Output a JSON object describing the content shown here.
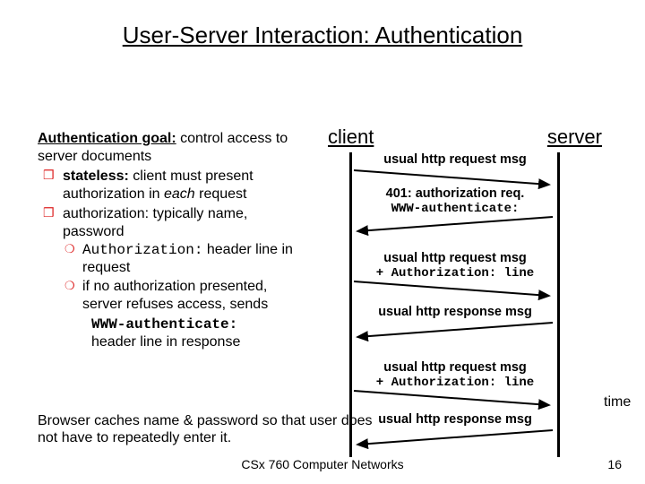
{
  "title": "User-Server Interaction: Authentication",
  "left": {
    "goal_label": "Authentication goal:",
    "goal_rest": " control access to server documents",
    "b1_a": "stateless:",
    "b1_b": " client must present authorization in ",
    "b1_c": "each",
    "b1_d": " request",
    "b2": "authorization: typically name, password",
    "s1_code": "Authorization:",
    "s1_rest": " header line in request",
    "s2_a": "if no authorization presented, server refuses access, sends",
    "s2_code": "WWW-authenticate:",
    "s2_rest": "header line in response"
  },
  "diagram": {
    "client": "client",
    "server": "server",
    "time": "time",
    "m1": "usual http request msg",
    "m2a": "401: authorization req.",
    "m2b": "WWW-authenticate:",
    "m3a": "usual http request msg",
    "m3b": "+ Authorization: line",
    "m4": "usual http response msg",
    "m5a": "usual http request msg",
    "m5b": "+ Authorization: line",
    "m6": "usual http response msg"
  },
  "bottom": "Browser caches name & password so that user does not have to repeatedly enter it.",
  "footer": "CSx 760 Computer Networks",
  "page": "16"
}
